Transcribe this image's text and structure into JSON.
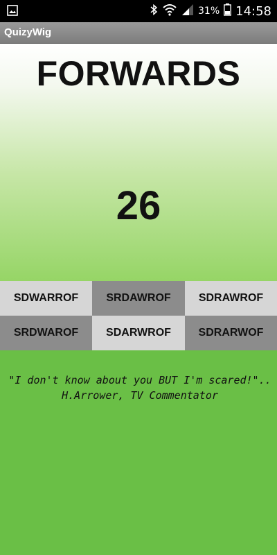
{
  "status_bar": {
    "battery_percent": "31%",
    "time": "14:58",
    "icons": [
      "gallery-icon",
      "bluetooth-icon",
      "wifi-icon",
      "signal-icon",
      "battery-icon"
    ]
  },
  "app": {
    "title": "QuizyWig"
  },
  "quiz": {
    "word": "FORWARDS",
    "score": "26",
    "answers": [
      {
        "label": "SDWARROF",
        "shade": "light"
      },
      {
        "label": "SRDAWROF",
        "shade": "dark"
      },
      {
        "label": "SDRAWROF",
        "shade": "light"
      },
      {
        "label": "SRDWAROF",
        "shade": "dark"
      },
      {
        "label": "SDARWROF",
        "shade": "light"
      },
      {
        "label": "SDRARWOF",
        "shade": "dark"
      }
    ],
    "quote": "\"I don't know about you BUT I'm scared!\"..  H.Arrower, TV Commentator"
  },
  "colors": {
    "background_green": "#6abf46",
    "tile_light": "#d6d6d6",
    "tile_dark": "#8c8c8c"
  }
}
